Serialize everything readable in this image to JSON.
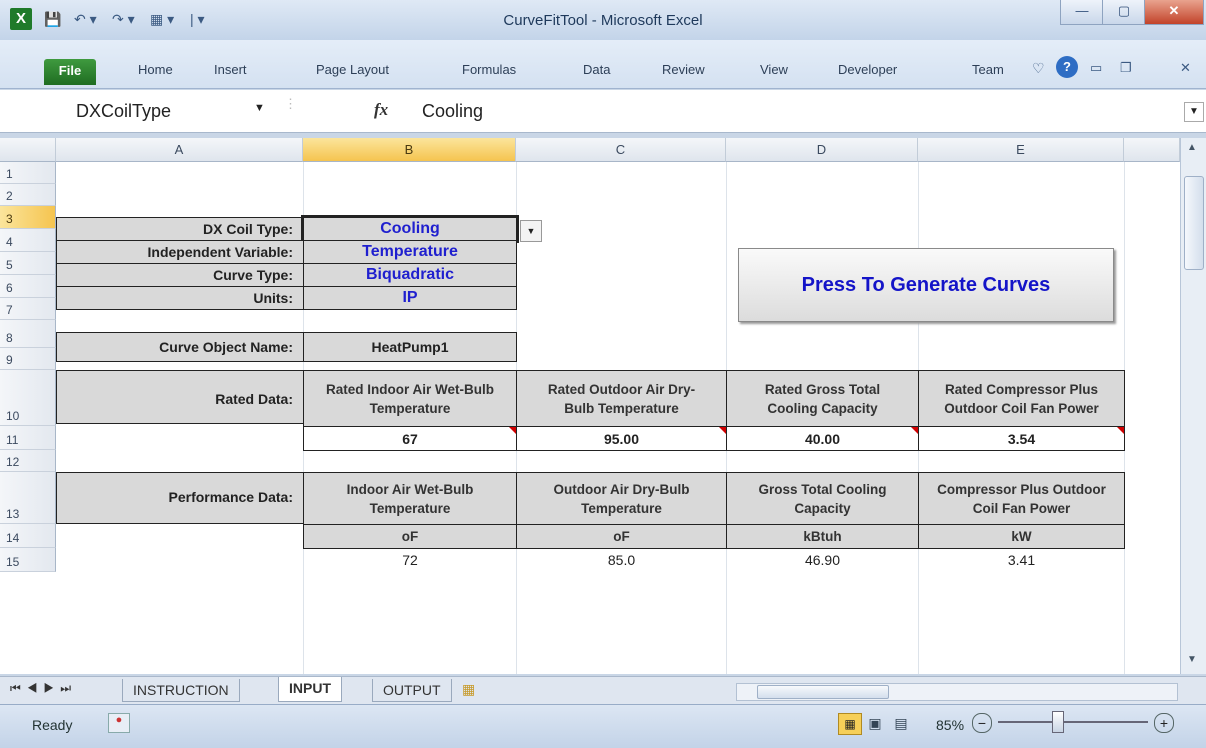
{
  "window": {
    "title": "CurveFitTool - Microsoft Excel",
    "controls": {
      "minimize": "—",
      "maximize": "▢",
      "close": "✕"
    }
  },
  "ribbon": {
    "file_tab": "File",
    "tabs": [
      "Home",
      "Insert",
      "Page Layout",
      "Formulas",
      "Data",
      "Review",
      "View",
      "Developer",
      "Team"
    ]
  },
  "formula_bar": {
    "name_box": "DXCoilType",
    "fx_label": "fx",
    "formula": "Cooling"
  },
  "columns": [
    "A",
    "B",
    "C",
    "D",
    "E"
  ],
  "rows": [
    "1",
    "2",
    "3",
    "4",
    "5",
    "6",
    "7",
    "8",
    "9",
    "10",
    "11",
    "12",
    "13",
    "14",
    "15"
  ],
  "settings": {
    "dx_coil_type_label": "DX Coil Type:",
    "dx_coil_type": "Cooling",
    "independent_variable_label": "Independent Variable:",
    "independent_variable": "Temperature",
    "curve_type_label": "Curve Type:",
    "curve_type": "Biquadratic",
    "units_label": "Units:",
    "units": "IP",
    "curve_object_name_label": "Curve Object Name:",
    "curve_object_name": "HeatPump1"
  },
  "generate_button": "Press To Generate Curves",
  "rated_data": {
    "label": "Rated Data:",
    "headers": [
      "Rated Indoor Air Wet-Bulb Temperature",
      "Rated Outdoor Air Dry-Bulb Temperature",
      "Rated Gross Total Cooling Capacity",
      "Rated Compressor Plus Outdoor Coil Fan Power"
    ],
    "values": [
      "67",
      "95.00",
      "40.00",
      "3.54"
    ]
  },
  "performance_data": {
    "label": "Performance Data:",
    "headers": [
      "Indoor Air Wet-Bulb Temperature",
      "Outdoor Air Dry-Bulb Temperature",
      "Gross Total Cooling Capacity",
      "Compressor Plus Outdoor Coil Fan Power"
    ],
    "units": [
      "oF",
      "oF",
      "kBtuh",
      "kW"
    ],
    "row15": [
      "72",
      "85.0",
      "46.90",
      "3.41"
    ]
  },
  "sheet_tabs": [
    "INSTRUCTION",
    "INPUT",
    "OUTPUT"
  ],
  "status": {
    "ready": "Ready",
    "zoom": "85%"
  }
}
